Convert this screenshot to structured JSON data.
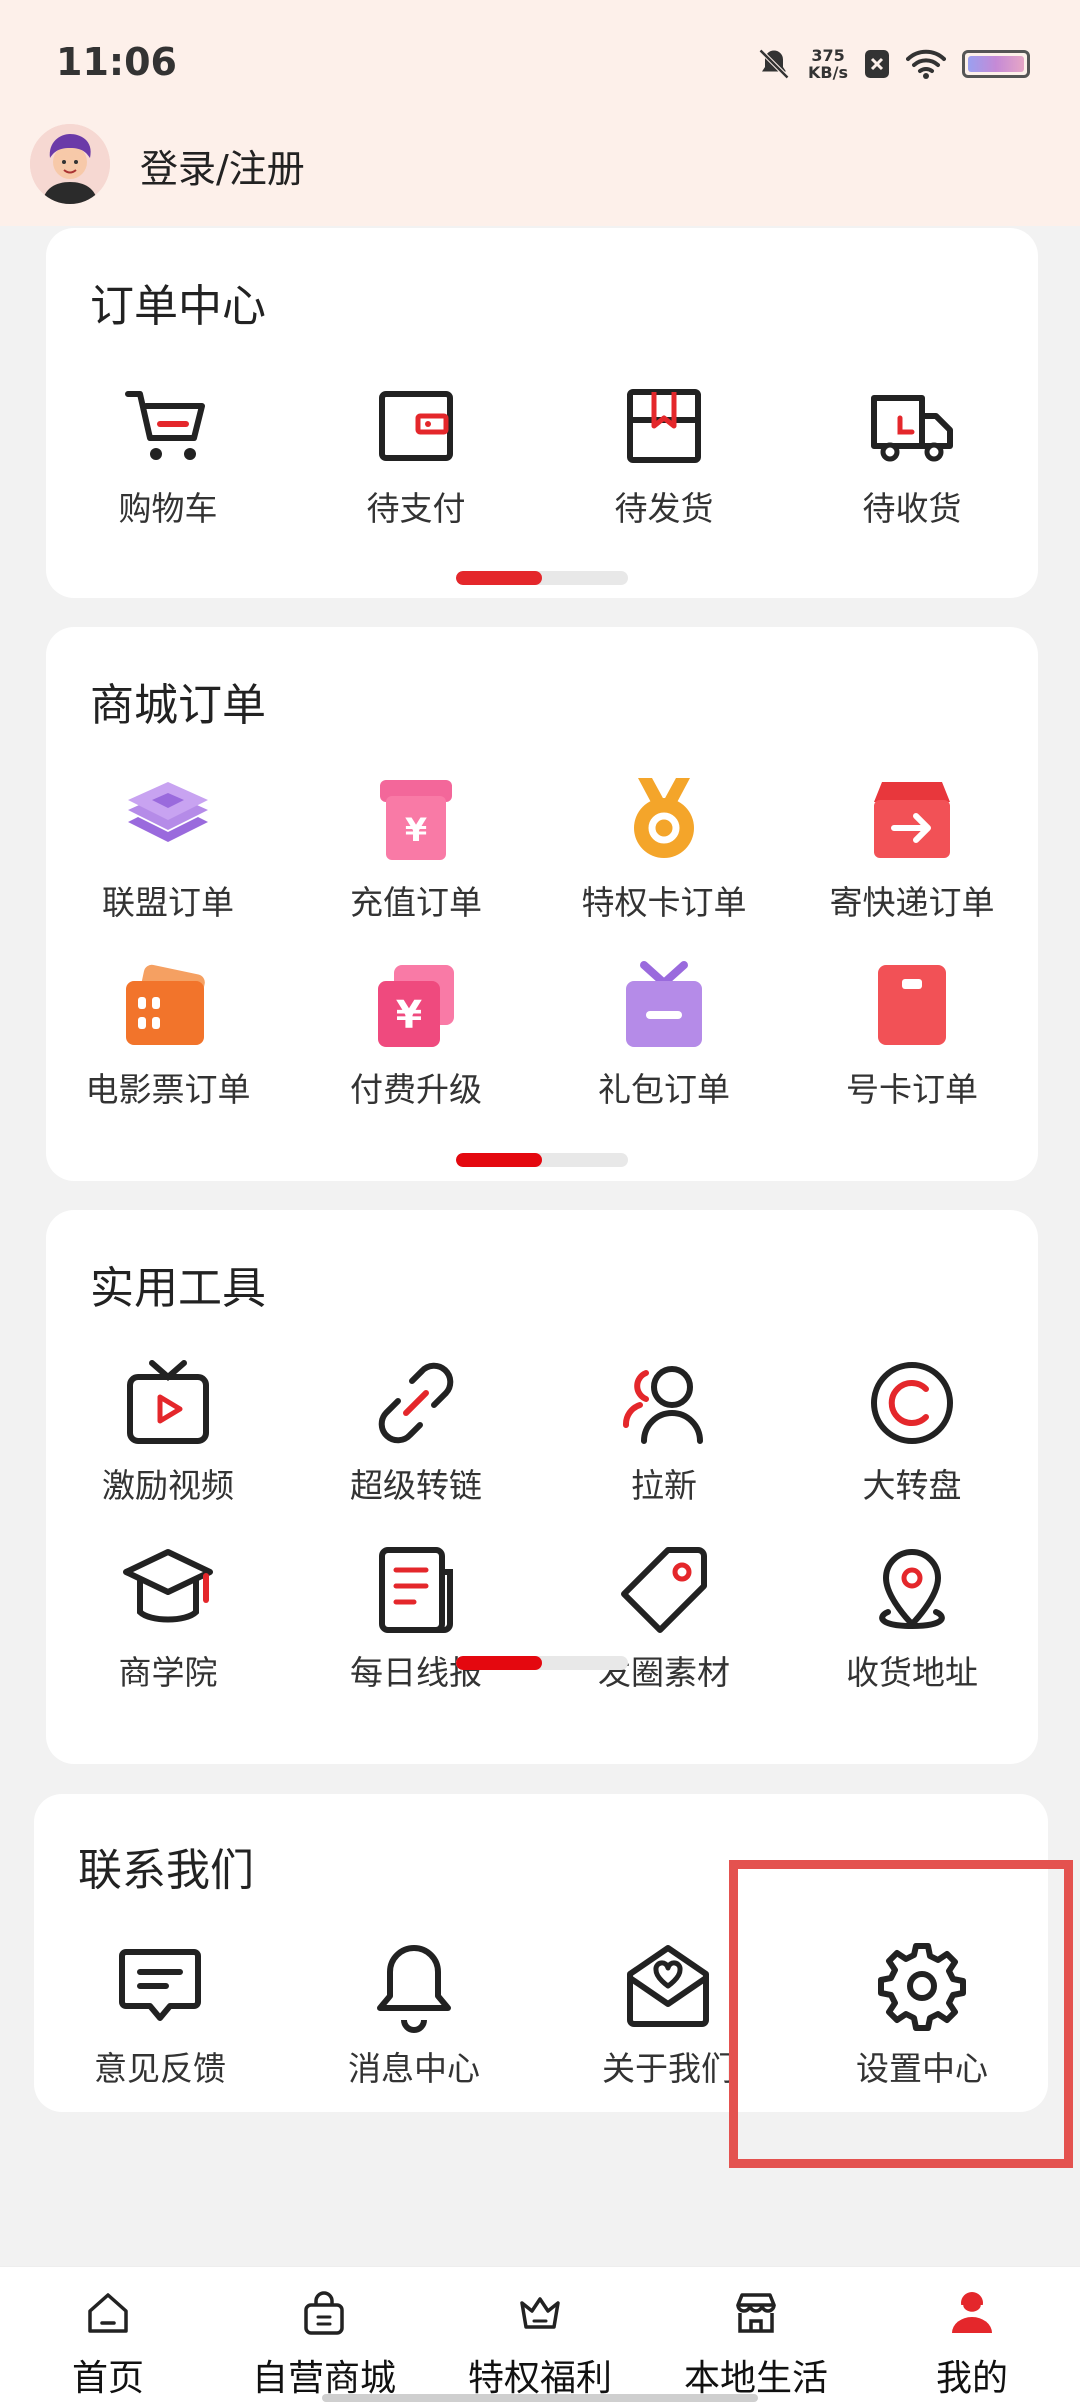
{
  "status": {
    "time": "11:06",
    "speed_value": "375",
    "speed_unit": "KB/s"
  },
  "header": {
    "login_label": "登录/注册"
  },
  "order_center": {
    "title": "订单中心",
    "items": [
      {
        "label": "购物车",
        "icon": "cart-icon"
      },
      {
        "label": "待支付",
        "icon": "wallet-icon"
      },
      {
        "label": "待发货",
        "icon": "box-icon"
      },
      {
        "label": "待收货",
        "icon": "truck-icon"
      }
    ]
  },
  "mall_orders": {
    "title": "商城订单",
    "items": [
      {
        "label": "联盟订单",
        "icon": "layers-icon"
      },
      {
        "label": "充值订单",
        "icon": "recharge-icon"
      },
      {
        "label": "特权卡订单",
        "icon": "medal-icon"
      },
      {
        "label": "寄快递订单",
        "icon": "express-icon"
      },
      {
        "label": "电影票订单",
        "icon": "ticket-icon"
      },
      {
        "label": "付费升级",
        "icon": "upgrade-icon"
      },
      {
        "label": "礼包订单",
        "icon": "gift-icon"
      },
      {
        "label": "号卡订单",
        "icon": "sim-card-icon"
      }
    ]
  },
  "tools": {
    "title": "实用工具",
    "items": [
      {
        "label": "激励视频",
        "icon": "tv-icon"
      },
      {
        "label": "超级转链",
        "icon": "link-icon"
      },
      {
        "label": "拉新",
        "icon": "users-icon"
      },
      {
        "label": "大转盘",
        "icon": "wheel-icon"
      },
      {
        "label": "商学院",
        "icon": "graduation-cap-icon"
      },
      {
        "label": "每日线报",
        "icon": "document-icon"
      },
      {
        "label": "发圈素材",
        "icon": "tag-icon"
      },
      {
        "label": "收货地址",
        "icon": "location-icon"
      }
    ]
  },
  "contact": {
    "title": "联系我们",
    "items": [
      {
        "label": "意见反馈",
        "icon": "feedback-icon"
      },
      {
        "label": "消息中心",
        "icon": "bell-icon"
      },
      {
        "label": "关于我们",
        "icon": "mail-heart-icon"
      },
      {
        "label": "设置中心",
        "icon": "gear-icon"
      }
    ]
  },
  "bottom_nav": [
    {
      "label": "首页",
      "icon": "home-icon"
    },
    {
      "label": "自营商城",
      "icon": "shopping-bag-icon"
    },
    {
      "label": "特权福利",
      "icon": "crown-icon"
    },
    {
      "label": "本地生活",
      "icon": "store-icon"
    },
    {
      "label": "我的",
      "icon": "profile-icon",
      "active": true
    }
  ],
  "colors": {
    "accent": "#e4272b",
    "header_bg": "#fdf0ea",
    "highlight": "#e4524f"
  }
}
